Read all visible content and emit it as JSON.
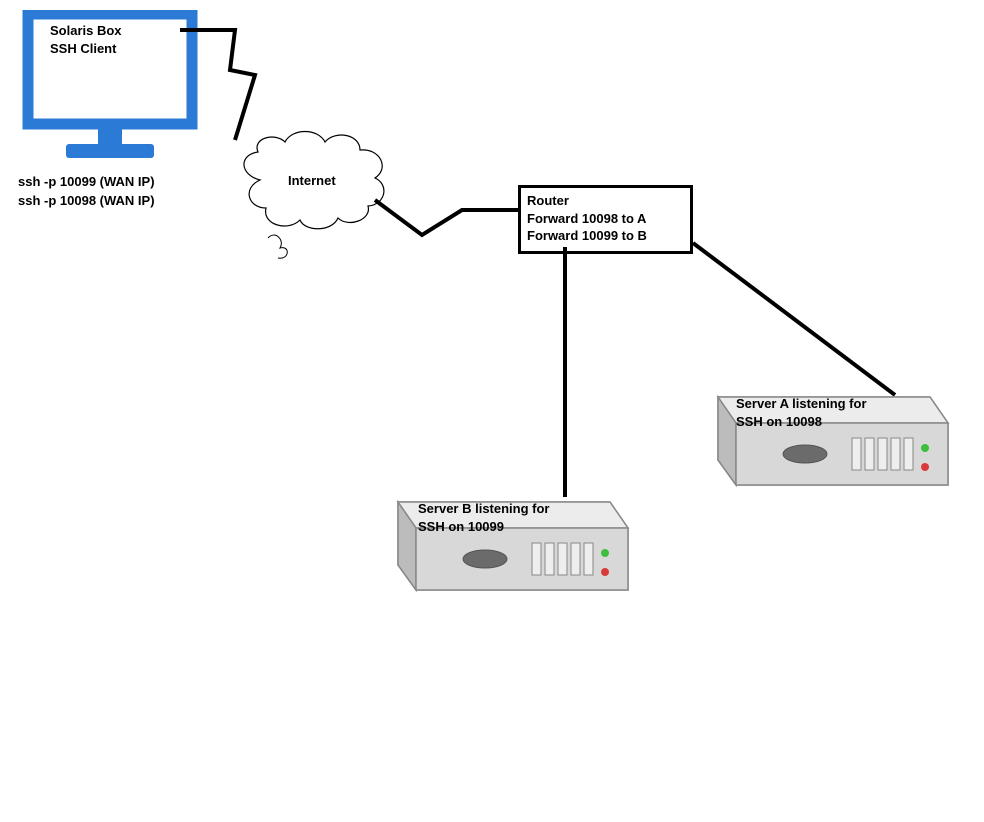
{
  "client": {
    "title_line1": "Solaris Box",
    "title_line2": "SSH Client",
    "command1": "ssh -p 10099 (WAN IP)",
    "command2": "ssh -p 10098 (WAN IP)"
  },
  "internet": {
    "label": "Internet"
  },
  "router": {
    "title": "Router",
    "rule1": "Forward 10098 to A",
    "rule2": "Forward 10099 to B"
  },
  "serverA": {
    "line1": "Server A listening for",
    "line2": "SSH on 10098"
  },
  "serverB": {
    "line1": "Server B listening for",
    "line2": "SSH on 10099"
  },
  "colors": {
    "monitor_blue": "#2b7bd6",
    "server_gray": "#d8d8d8",
    "server_gray_light": "#e8e8e8",
    "server_gray_dark": "#b0b0b0"
  }
}
